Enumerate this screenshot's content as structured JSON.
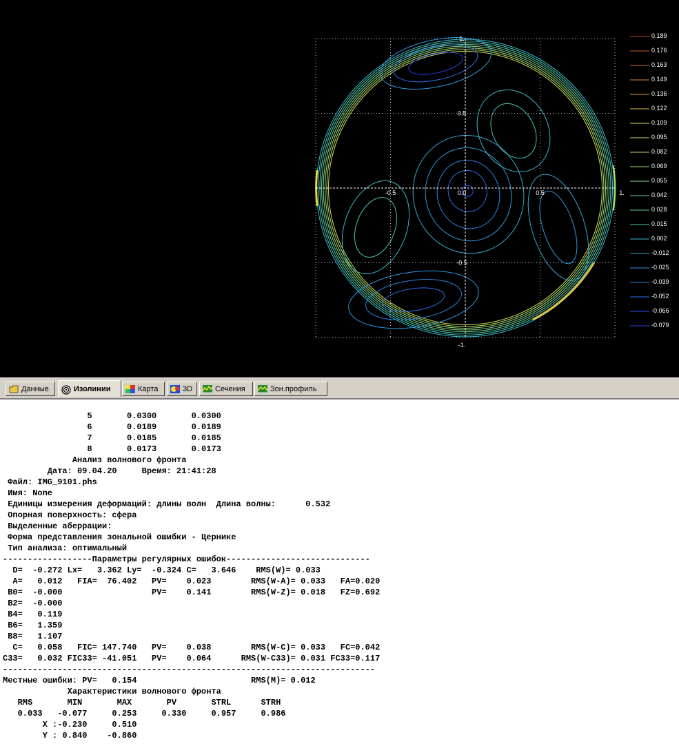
{
  "plot": {
    "axis_tick_labels": [
      "1.",
      "0.5",
      "0.0",
      "-0.5",
      "-1.",
      "-0.5",
      "0.0",
      "0.5",
      "1."
    ],
    "axis_ticks": {
      "y": [
        {
          "value": 1,
          "label": "1."
        },
        {
          "value": 0.5,
          "label": "0.5"
        },
        {
          "value": 0,
          "label": "0.0"
        },
        {
          "value": -0.5,
          "label": "-0.5"
        },
        {
          "value": -1,
          "label": "-1."
        }
      ],
      "x": [
        {
          "value": -0.5,
          "label": "-0.5"
        },
        {
          "value": 0.5,
          "label": "0.5"
        },
        {
          "value": 1,
          "label": "1."
        }
      ]
    },
    "legend": [
      {
        "label": "0.189",
        "color": "#c83a2a"
      },
      {
        "label": "0.176",
        "color": "#d2502a"
      },
      {
        "label": "0.163",
        "color": "#d66a2c"
      },
      {
        "label": "0.149",
        "color": "#da842e"
      },
      {
        "label": "0.136",
        "color": "#dc9e34"
      },
      {
        "label": "0.122",
        "color": "#e0be40"
      },
      {
        "label": "0.109",
        "color": "#e0d84a"
      },
      {
        "label": "0.095",
        "color": "#cce05a"
      },
      {
        "label": "0.082",
        "color": "#b4e06a"
      },
      {
        "label": "0.069",
        "color": "#9cdc7a"
      },
      {
        "label": "0.055",
        "color": "#84d88a"
      },
      {
        "label": "0.042",
        "color": "#6cd49a"
      },
      {
        "label": "0.028",
        "color": "#58ceaa"
      },
      {
        "label": "0.015",
        "color": "#48c6ba"
      },
      {
        "label": "0.002",
        "color": "#3cbcc8"
      },
      {
        "label": "-0.012",
        "color": "#34acd4"
      },
      {
        "label": "-0.025",
        "color": "#2e9ade"
      },
      {
        "label": "-0.039",
        "color": "#2a86e6"
      },
      {
        "label": "-0.052",
        "color": "#2a70ea"
      },
      {
        "label": "-0.066",
        "color": "#2c58ec"
      },
      {
        "label": "-0.079",
        "color": "#3040ee"
      }
    ]
  },
  "tabs": [
    {
      "label": "Данные",
      "icon": "folder-icon",
      "active": false
    },
    {
      "label": "Изолинии",
      "icon": "target-icon",
      "active": true
    },
    {
      "label": "Карта",
      "icon": "color-map-icon",
      "active": false
    },
    {
      "label": "3D",
      "icon": "3d-icon",
      "active": false
    },
    {
      "label": "Сечения",
      "icon": "sections-icon",
      "active": false
    },
    {
      "label": "Зон.профиль",
      "icon": "zonal-profile-icon",
      "active": false
    }
  ],
  "report_lines": [
    "                 5       0.0300       0.0300",
    "                 6       0.0189       0.0189",
    "                 7       0.0185       0.0185",
    "                 8       0.0173       0.0173",
    "              Анализ волнового фронта",
    "         Дата: 09.04.20     Время: 21:41:28",
    " Файл: IMG_9101.phs",
    " Имя: None",
    " Единицы измерения деформаций: длины волн  Длина волны:      0.532",
    " Опорная поверхность: сфера",
    " Выделенные аберрации:",
    " Форма представления зональной ошибки - Цернике",
    " Тип анализа: оптимальный",
    "------------------Параметры регулярных ошибок-----------------------------",
    "  D=  -0.272 Lx=   3.362 Ly=  -0.324 C=   3.646    RMS(W)= 0.033",
    "  A=   0.012   FIA=  76.402   PV=    0.023        RMS(W-A)= 0.033   FA=0.020",
    " B0=  -0.000                  PV=    0.141        RMS(W-Z)= 0.018   FZ=0.692",
    " B2=  -0.000",
    " B4=   0.119",
    " B6=   1.359",
    " B8=   1.107",
    "  C=   0.058   FIC= 147.740   PV=    0.038        RMS(W-C)= 0.033   FC=0.042",
    "C33=   0.032 FIC33= -41.051   PV=    0.064      RMS(W-C33)= 0.031 FC33=0.117",
    "---------------------------------------------------------------------------",
    "Местные ошибки: PV=   0.154                       RMS(M)= 0.012",
    "             Характеристики волнового фронта",
    "   RMS       MIN       MAX       PV       STRL      STRH",
    "   0.033   -0.077     0.253     0.330     0.957     0.986",
    "        X :-0.230     0.510",
    "        Y : 0.840    -0.860"
  ]
}
